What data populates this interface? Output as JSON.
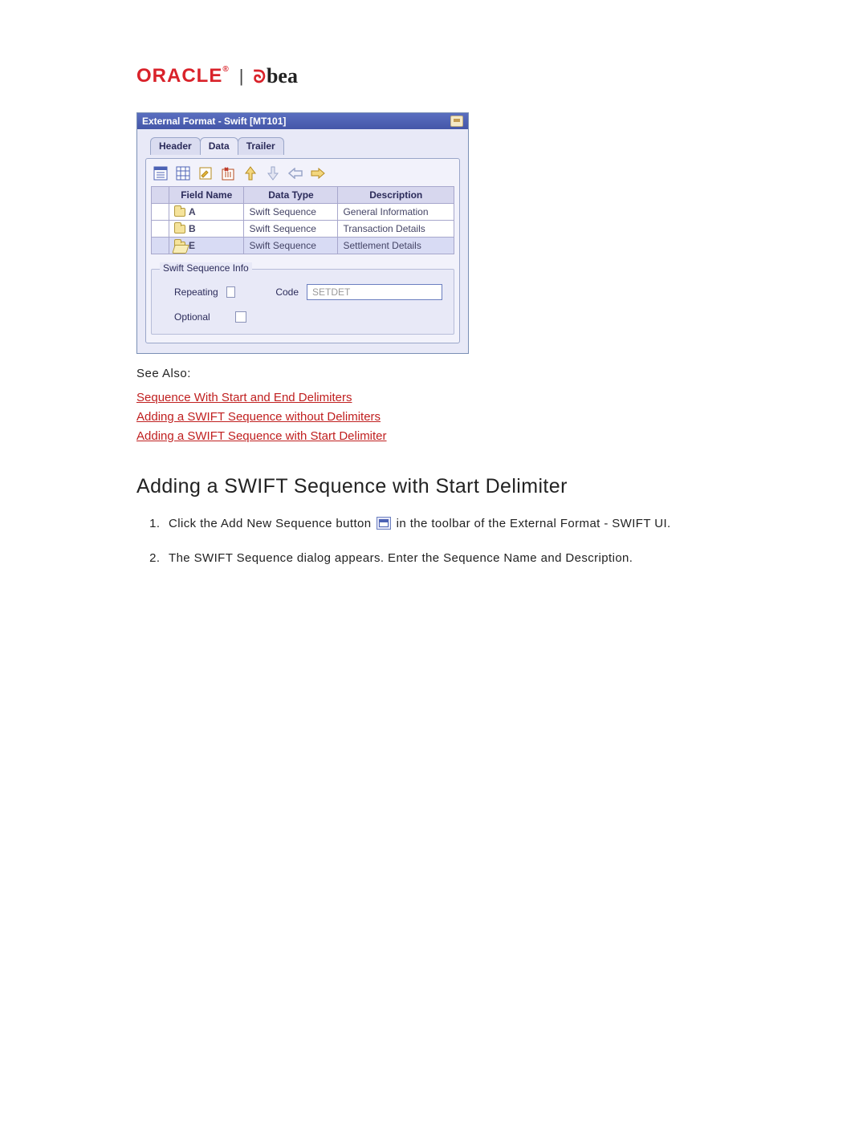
{
  "logos": {
    "oracle": "ORACLE",
    "sep": "|",
    "bea": "bea"
  },
  "panel": {
    "title": "External Format - Swift [MT101]",
    "tabs": [
      "Header",
      "Data",
      "Trailer"
    ],
    "active_tab_index": 1,
    "columns": [
      "Field Name",
      "Data Type",
      "Description"
    ],
    "rows": [
      {
        "name": "A",
        "type": "Swift Sequence",
        "desc": "General Information",
        "open": false
      },
      {
        "name": "B",
        "type": "Swift Sequence",
        "desc": "Transaction Details",
        "open": false
      },
      {
        "name": "E",
        "type": "Swift Sequence",
        "desc": "Settlement Details",
        "open": true,
        "selected": true
      }
    ],
    "seq_info": {
      "legend": "Swift Sequence Info",
      "repeating_label": "Repeating",
      "optional_label": "Optional",
      "code_label": "Code",
      "code_value": "SETDET"
    }
  },
  "see_also": {
    "heading": "See Also:",
    "links": [
      "Sequence With Start and End Delimiters",
      "Adding a SWIFT Sequence without Delimiters",
      "Adding a SWIFT Sequence with Start Delimiter"
    ]
  },
  "section": {
    "heading": "Adding a SWIFT Sequence with Start Delimiter",
    "step1_a": "Click the Add New Sequence button ",
    "step1_b": " in the toolbar of the External Format - SWIFT UI.",
    "step2": "The SWIFT Sequence dialog appears. Enter the Sequence Name and Description."
  }
}
